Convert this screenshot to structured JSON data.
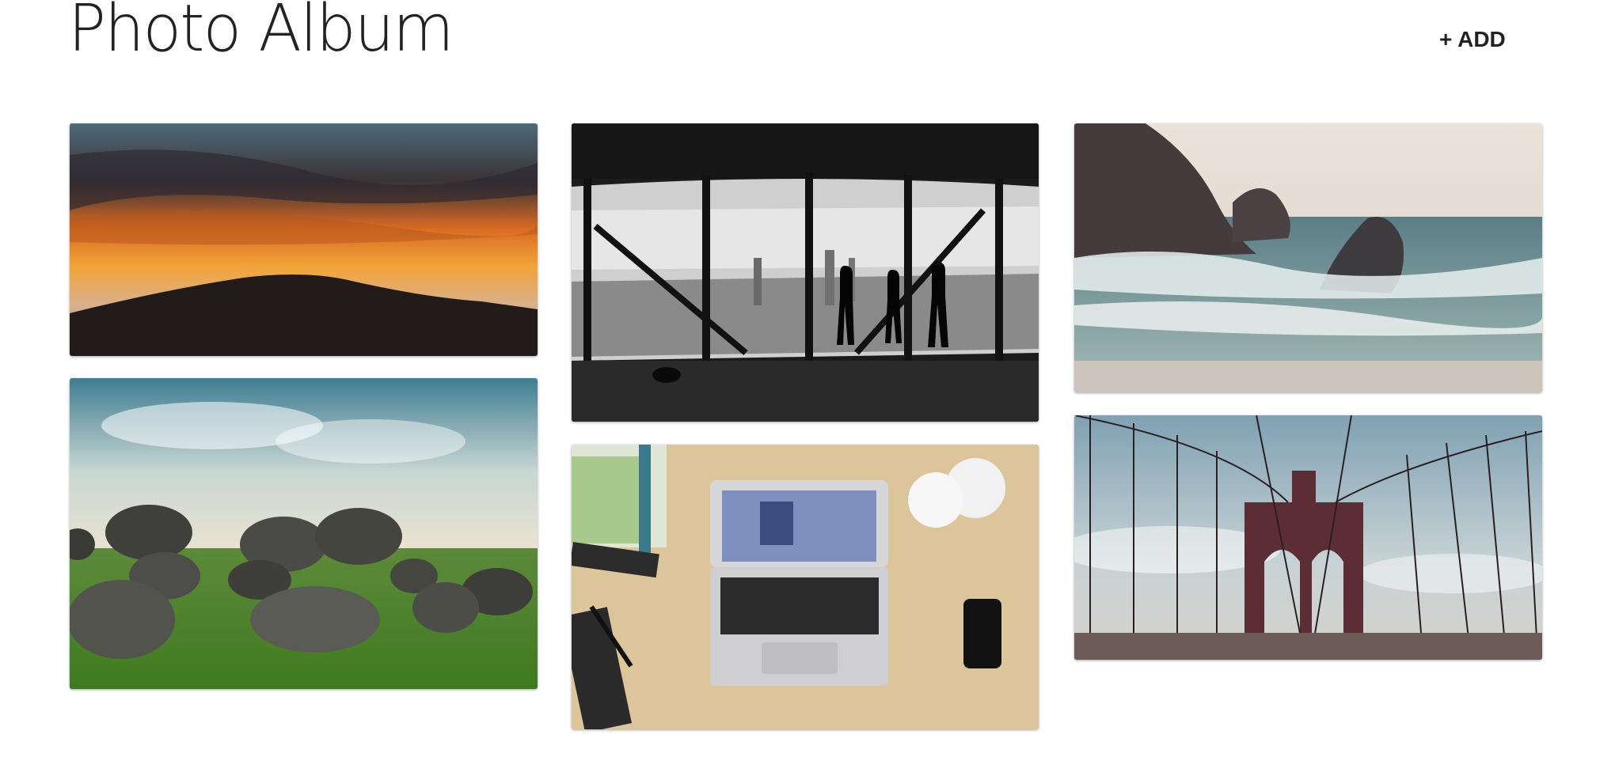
{
  "header": {
    "title": "Photo Album",
    "add_label": "+ ADD"
  },
  "photos": [
    {
      "subject": "Sunset sky over a forested hill silhouette",
      "icon": "sunset-photo"
    },
    {
      "subject": "Large boulders in a grassy field under a bright cloudy sky",
      "icon": "boulders-photo"
    },
    {
      "subject": "Black and white silhouettes of people at a city-view window",
      "icon": "city-window-photo"
    },
    {
      "subject": "Top-down view of a laptop on a wooden desk with books, phone and lamp",
      "icon": "desk-laptop-photo"
    },
    {
      "subject": "Waves crashing on rocky coastline",
      "icon": "coast-waves-photo"
    },
    {
      "subject": "Suspension bridge cables and stone tower",
      "icon": "bridge-photo"
    }
  ],
  "colors": {
    "title": "#222222",
    "background": "#ffffff"
  }
}
